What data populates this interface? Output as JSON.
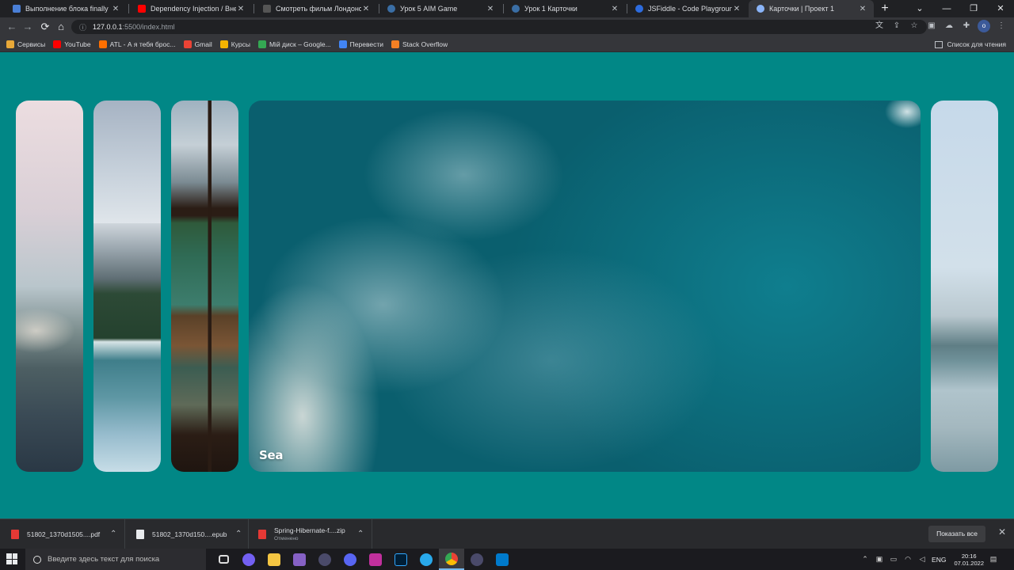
{
  "tabs": [
    {
      "title": "Выполнение блока finally",
      "favicon_color": "#4a7fd6"
    },
    {
      "title": "Dependency Injection / Внедрение",
      "favicon_color": "#ff0000"
    },
    {
      "title": "Смотреть фильм Лондонские",
      "favicon_color": "#555555"
    },
    {
      "title": "Урок 5 AIM Game",
      "favicon_color": "#3a6ea5"
    },
    {
      "title": "Урок 1 Карточки",
      "favicon_color": "#3a6ea5"
    },
    {
      "title": "JSFiddle - Code Playground",
      "favicon_color": "#2d6cdf"
    },
    {
      "title": "Карточки | Проект 1",
      "favicon_color": "#8ab4f8"
    }
  ],
  "address_bar": {
    "host": "127.0.0.1",
    "path": ":5500/index.html"
  },
  "bookmarks": [
    {
      "label": "Сервисы",
      "color": "#e8a838"
    },
    {
      "label": "YouTube",
      "color": "#ff0000"
    },
    {
      "label": "ATL - А я тебя брос...",
      "color": "#ff6f00"
    },
    {
      "label": "Gmail",
      "color": "#ea4335"
    },
    {
      "label": "Курсы",
      "color": "#f4b400"
    },
    {
      "label": "Мій диск – Google...",
      "color": "#34a853"
    },
    {
      "label": "Перевести",
      "color": "#4285f4"
    },
    {
      "label": "Stack Overflow",
      "color": "#f48024"
    }
  ],
  "reading_list": "Список для чтения",
  "cards": [
    {
      "title": ""
    },
    {
      "title": ""
    },
    {
      "title": ""
    },
    {
      "title": "Sea"
    },
    {
      "title": ""
    }
  ],
  "downloads": [
    {
      "name": "51802_1370d1505....pdf",
      "status": "",
      "color": "#e53935"
    },
    {
      "name": "51802_1370d150....epub",
      "status": "",
      "color": "#e8eaed"
    },
    {
      "name": "Spring-Hibernate-f....zip",
      "status": "Отменено",
      "color": "#e53935"
    }
  ],
  "show_all_label": "Показать все",
  "taskbar": {
    "search_placeholder": "Введите здесь текст для поиска",
    "lang": "ENG",
    "time": "20:16",
    "date": "07.01.2022"
  }
}
